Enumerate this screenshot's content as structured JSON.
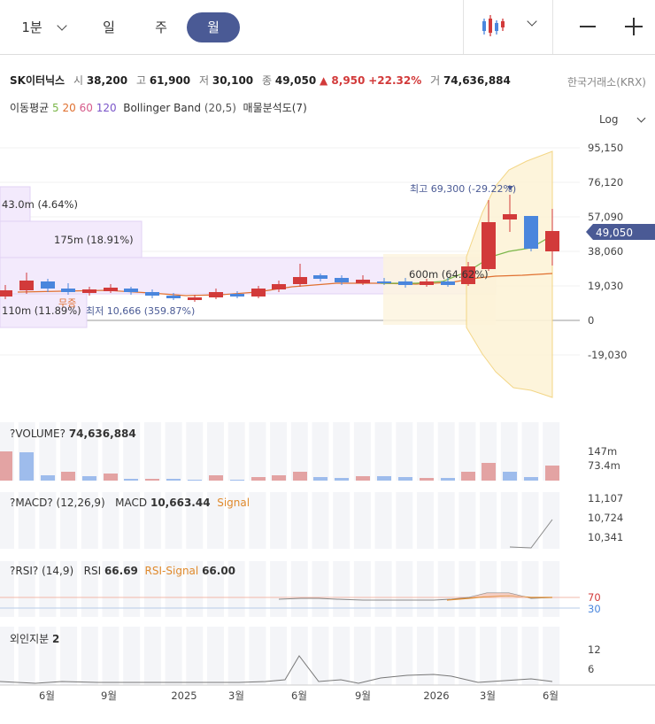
{
  "periods": {
    "minute": "1분",
    "day": "일",
    "week": "주",
    "month": "월"
  },
  "stock": {
    "name": "SK이터닉스",
    "open_label": "시",
    "open": "38,200",
    "high_label": "고",
    "high": "61,900",
    "low_label": "저",
    "low": "30,100",
    "close_label": "종",
    "close": "49,050",
    "change": "▲ 8,950",
    "change_pct": "+22.32%",
    "volume_label": "거",
    "volume": "74,636,884",
    "exchange": "한국거래소(KRX)"
  },
  "indicators": {
    "ma_label": "이동평균",
    "ma5": "5",
    "ma20": "20",
    "ma60": "60",
    "ma120": "120",
    "bollinger": "Bollinger Band",
    "bollinger_params": "(20,5)",
    "volume_profile": "매물분석도(7)",
    "scale": "Log"
  },
  "price_axis": [
    "95,150",
    "76,120",
    "57,090",
    "38,060",
    "19,030",
    "0",
    "-19,030"
  ],
  "current_price_tag": "49,050",
  "annotations": {
    "high": "최고 69,300 (-29.22%)",
    "low": "최저 10,666 (359.87%)",
    "free_increase": "무증",
    "vp1": "43.0m (4.64%)",
    "vp2": "175m (18.91%)",
    "vp3": "600m (64.62%)",
    "vp4": "110m (11.89%)"
  },
  "volume_panel": {
    "title": "?VOLUME?",
    "value": "74,636,884",
    "axis": [
      "147m",
      "73.4m"
    ]
  },
  "macd_panel": {
    "title": "?MACD?",
    "params": "(12,26,9)",
    "macd_label": "MACD",
    "macd_value": "10,663.44",
    "signal_label": "Signal",
    "axis": [
      "11,107",
      "10,724",
      "10,341"
    ]
  },
  "rsi_panel": {
    "title": "?RSI?",
    "params": "(14,9)",
    "rsi_label": "RSI",
    "rsi_value": "66.69",
    "signal_label": "RSI-Signal",
    "signal_value": "66.00",
    "axis": [
      "70",
      "30"
    ]
  },
  "foreign_panel": {
    "title": "외인지분",
    "value": "2",
    "axis": [
      "12",
      "6"
    ]
  },
  "x_axis": [
    "6월",
    "9월",
    "2025",
    "3월",
    "6월",
    "9월",
    "2026",
    "3월",
    "6월"
  ],
  "colors": {
    "up": "#d23a3a",
    "down": "#4a86dd",
    "active_tab": "#4a5a95"
  }
}
